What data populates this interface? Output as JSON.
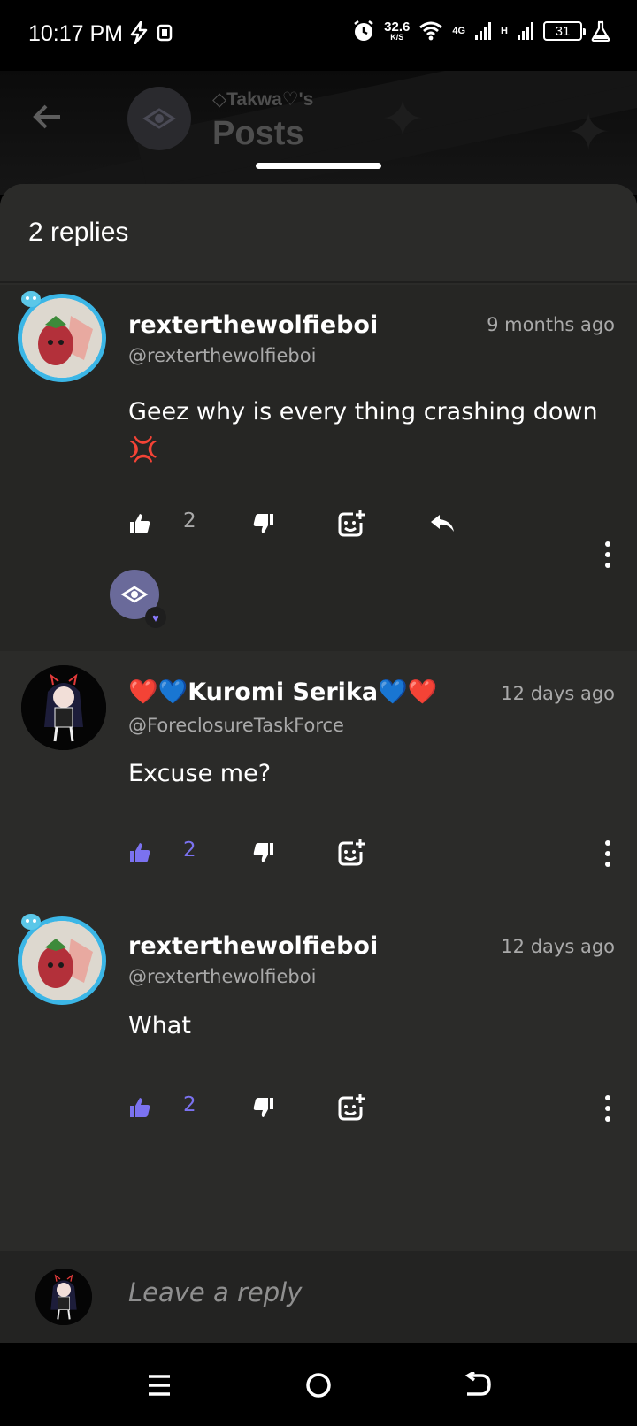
{
  "status_bar": {
    "time": "10:17 PM",
    "net_speed": "32.6",
    "net_unit": "K/S",
    "network_4g": "4G",
    "network_h": "H",
    "battery": "31"
  },
  "header": {
    "group_name": "◇Takwa♡'s",
    "title": "Posts"
  },
  "sheet": {
    "replies_count_label": "2 replies"
  },
  "parent_post": {
    "username": "rexterthewolfieboi",
    "handle": "@rexterthewolfieboi",
    "time": "9 months ago",
    "text": "Geez why is every thing crashing down",
    "emoji": "💢",
    "likes": "2"
  },
  "replies": [
    {
      "username": "❤️💙Kuromi Serika💙❤️",
      "handle": "@ForeclosureTaskForce",
      "time": "12 days ago",
      "text": "Excuse me?",
      "likes": "2",
      "liked": true
    },
    {
      "username": "rexterthewolfieboi",
      "handle": "@rexterthewolfieboi",
      "time": "12 days ago",
      "text": "What",
      "likes": "2",
      "liked": true
    }
  ],
  "composer": {
    "placeholder": "Leave a reply"
  },
  "colors": {
    "accent": "#7b72f0",
    "sheet_bg": "#2b2b29",
    "post_bg": "#262624",
    "avatar_ring": "#3bb6e6"
  }
}
